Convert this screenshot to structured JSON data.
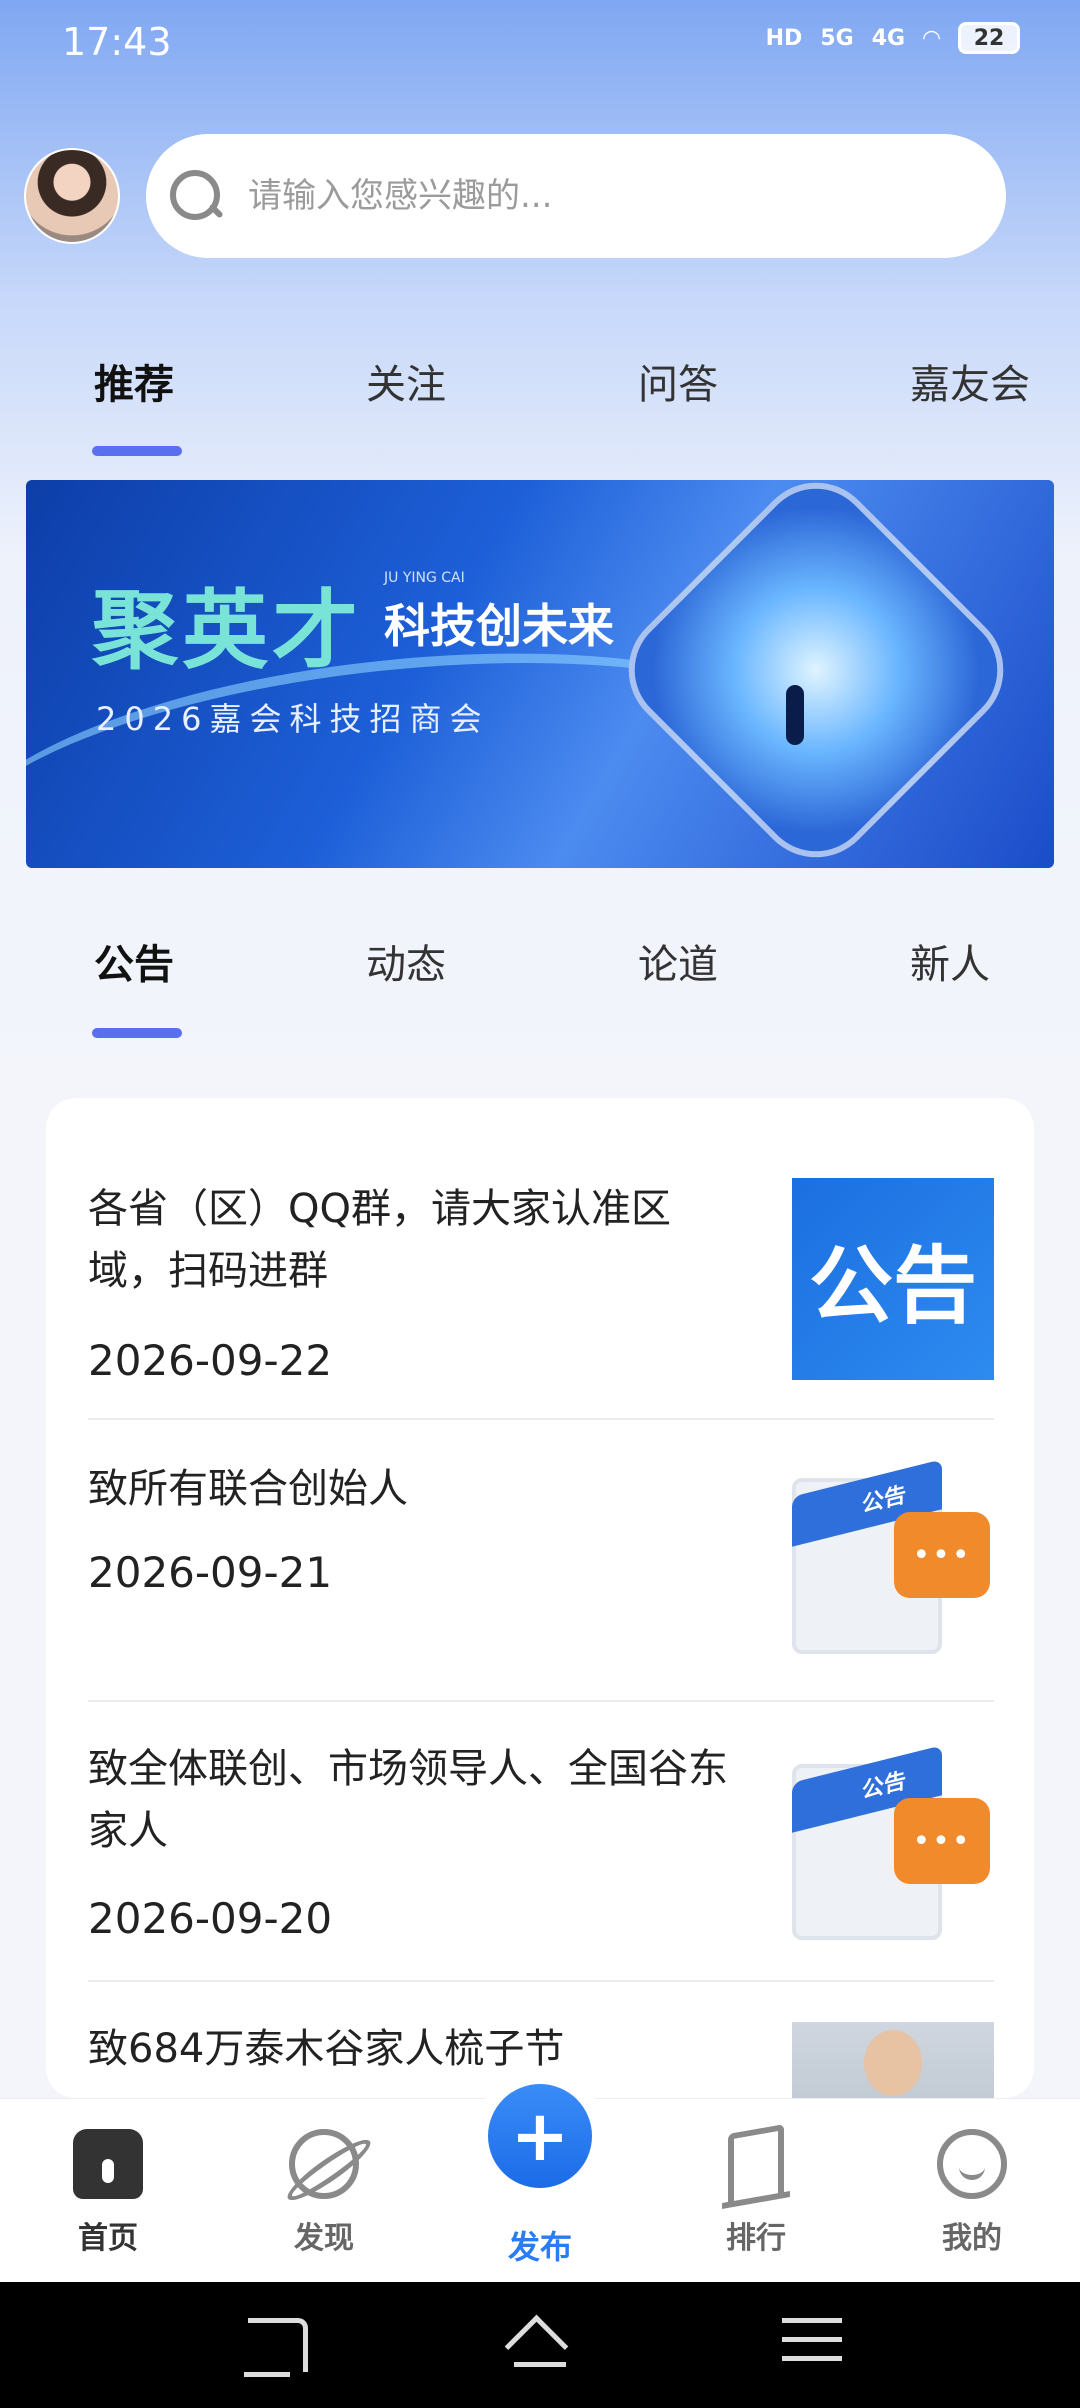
{
  "status_bar": {
    "time": "17:43",
    "signal_labels": [
      "HD",
      "5G",
      "4G"
    ],
    "battery": "22"
  },
  "search": {
    "placeholder": "请输入您感兴趣的..."
  },
  "top_tabs": [
    {
      "label": "推荐",
      "active": true
    },
    {
      "label": "关注",
      "active": false
    },
    {
      "label": "问答",
      "active": false
    },
    {
      "label": "嘉友会",
      "active": false
    }
  ],
  "banner": {
    "title": "聚英才",
    "en": "JU YING CAI",
    "subtitle": "科技创未来",
    "line": "2026嘉会科技招商会"
  },
  "section_tabs": [
    {
      "label": "公告",
      "active": true
    },
    {
      "label": "动态",
      "active": false
    },
    {
      "label": "论道",
      "active": false
    },
    {
      "label": "新人",
      "active": false
    }
  ],
  "articles": [
    {
      "title": "各省（区）QQ群，请大家认准区域，扫码进群",
      "date": "2026-09-22",
      "thumb": "公告"
    },
    {
      "title": "致所有联合创始人",
      "date": "2026-09-21",
      "thumb": "公告"
    },
    {
      "title": "致全体联创、市场领导人、全国谷东家人",
      "date": "2026-09-20",
      "thumb": "公告"
    },
    {
      "title": "致684万泰木谷家人梳子节",
      "date": "",
      "thumb": ""
    }
  ],
  "bottom_nav": [
    {
      "label": "首页",
      "icon": "home-icon"
    },
    {
      "label": "发现",
      "icon": "planet-icon"
    },
    {
      "label": "发布",
      "icon": "plus-icon"
    },
    {
      "label": "排行",
      "icon": "rank-icon"
    },
    {
      "label": "我的",
      "icon": "smile-icon"
    }
  ],
  "publish_symbol": "+",
  "thumb_bubble_dots": "•••",
  "colors": {
    "accent": "#5a6ef0",
    "publish": "#2a7cf2"
  }
}
